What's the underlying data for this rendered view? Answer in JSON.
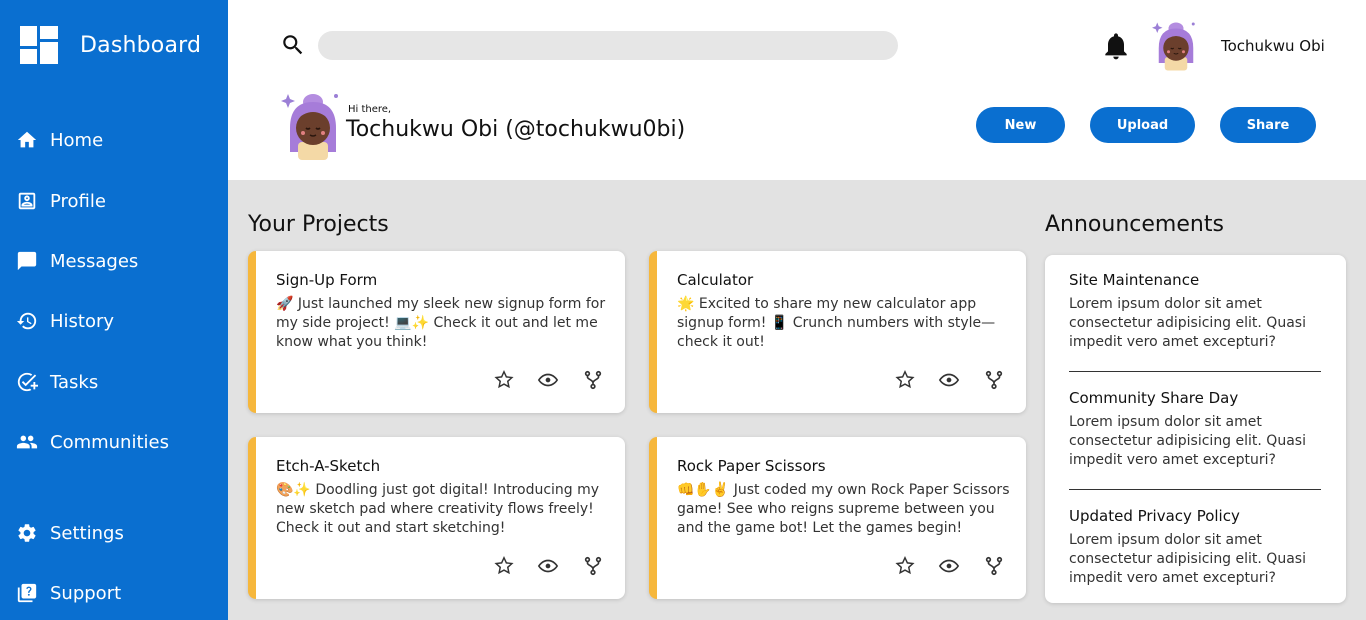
{
  "sidebar": {
    "title": "Dashboard",
    "items": [
      {
        "label": "Home",
        "icon": "home-icon"
      },
      {
        "label": "Profile",
        "icon": "profile-icon"
      },
      {
        "label": "Messages",
        "icon": "message-icon"
      },
      {
        "label": "History",
        "icon": "history-icon"
      },
      {
        "label": "Tasks",
        "icon": "tasks-icon"
      },
      {
        "label": "Communities",
        "icon": "communities-icon"
      },
      {
        "label": "Settings",
        "icon": "gear-icon"
      },
      {
        "label": "Support",
        "icon": "support-icon"
      }
    ]
  },
  "header": {
    "search_placeholder": "",
    "user_name": "Tochukwu Obi",
    "greeting_small": "Hi there,",
    "greeting_name": "Tochukwu Obi (@tochukwu0bi)",
    "buttons": {
      "new": "New",
      "upload": "Upload",
      "share": "Share"
    }
  },
  "projects": {
    "title": "Your Projects",
    "items": [
      {
        "title": "Sign-Up Form",
        "desc": "🚀 Just launched my sleek new signup form for my side project! 💻✨ Check it out and let me know what you think!"
      },
      {
        "title": "Calculator",
        "desc": "🌟 Excited to share my new calculator app signup form! 📱 Crunch numbers with style—check it out!"
      },
      {
        "title": "Etch-A-Sketch",
        "desc": "🎨✨ Doodling just got digital! Introducing my new sketch pad where creativity flows freely! Check it out and start sketching!"
      },
      {
        "title": "Rock Paper Scissors",
        "desc": "👊✋✌️ Just coded my own Rock Paper Scissors game! See who reigns supreme between you and the game bot! Let the games begin!"
      }
    ]
  },
  "announcements": {
    "title": "Announcements",
    "items": [
      {
        "title": "Site Maintenance",
        "body": "Lorem ipsum dolor sit amet consectetur adipisicing elit. Quasi impedit vero amet excepturi?"
      },
      {
        "title": "Community Share Day",
        "body": "Lorem ipsum dolor sit amet consectetur adipisicing elit. Quasi impedit vero amet excepturi?"
      },
      {
        "title": "Updated Privacy Policy",
        "body": "Lorem ipsum dolor sit amet consectetur adipisicing elit. Quasi impedit vero amet excepturi?"
      }
    ]
  },
  "colors": {
    "brand": "#0a6fd0",
    "accent": "#f6b73c",
    "background": "#e2e2e2"
  }
}
